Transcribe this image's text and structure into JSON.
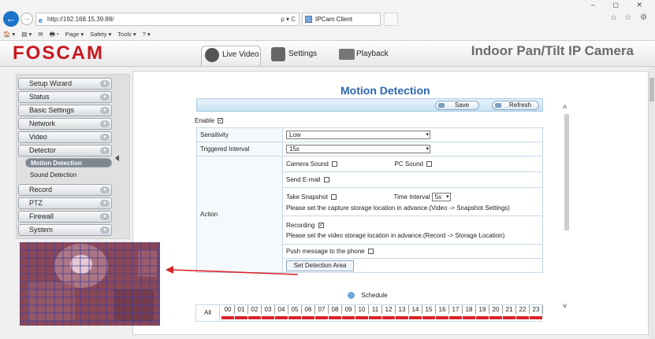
{
  "browser": {
    "url": "http://192.168.15.39:88/",
    "address_tools": "ρ ▾ C",
    "tab_title": "IPCam Client",
    "window_controls": "–  ◻  ✕",
    "right_icons": "⌂ ☆ ⚙",
    "command_bar": [
      "🏠 ▾",
      "▤ ▾",
      "✉",
      "🖶 ▾",
      "Page ▾",
      "Safety ▾",
      "Tools ▾",
      "? ▾"
    ]
  },
  "header": {
    "brand": "FOSCAM",
    "tabs": [
      "Live Video",
      "Settings",
      "Playback"
    ],
    "camera_model": "Indoor Pan/Tilt IP Camera"
  },
  "sidebar": {
    "items": [
      "Setup Wizard",
      "Status",
      "Basic Settings",
      "Network",
      "Video",
      "Detector"
    ],
    "sub_items": [
      "Motion Detection",
      "Sound Detection"
    ],
    "items_after": [
      "Record",
      "PTZ",
      "Firewall",
      "System"
    ]
  },
  "main": {
    "title": "Motion Detection",
    "save_label": "Save",
    "refresh_label": "Refresh",
    "enable_label": "Enable",
    "enable_checked": "✓",
    "sensitivity_label": "Sensitivity",
    "sensitivity_value": "Low",
    "interval_label": "Triggered Interval",
    "interval_value": "15s",
    "action_label": "Action",
    "camera_sound": "Camera Sound",
    "pc_sound": "PC Sound",
    "send_email": "Send E-mail",
    "take_snapshot": "Take Snapshot",
    "time_interval_label": "Time Interval",
    "time_interval_value": "5s",
    "snapshot_note": "Please set the capture storage location in advance.(Video -> Snapshot Settings)",
    "recording": "Recording",
    "recording_checked": "✓",
    "record_note": "Please set the video storage location in advance.(Record -> Storage Location)",
    "push_message": "Push message to the phone",
    "detect_area_button": "Set Detection Area",
    "schedule_label": "Schedule",
    "all_label": "All",
    "hours": [
      "00",
      "01",
      "02",
      "03",
      "04",
      "05",
      "06",
      "07",
      "08",
      "09",
      "10",
      "11",
      "12",
      "13",
      "14",
      "15",
      "16",
      "17",
      "18",
      "19",
      "20",
      "21",
      "22",
      "23"
    ]
  },
  "colors": {
    "brand_red": "#c8171e",
    "title_blue": "#2e67b1",
    "schedule_bar": "#d8232a",
    "grid_line": "#3a3f9c"
  }
}
